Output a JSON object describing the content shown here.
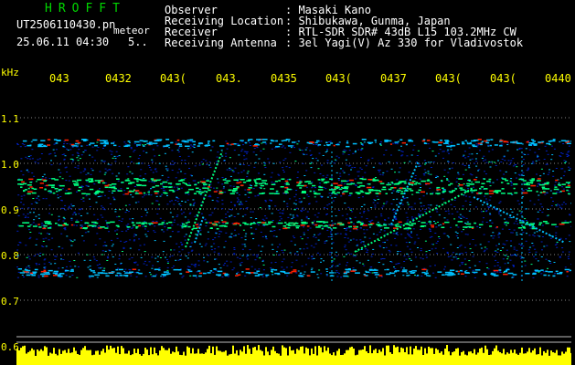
{
  "header": {
    "app_title": "HROFFT",
    "filename": "UT2506110430.pn",
    "mode": "meteor",
    "datetime": "25.06.11 04:30",
    "extra": "5..",
    "fields": [
      {
        "label": "Observer",
        "value": ": Masaki Kano"
      },
      {
        "label": "Receiving Location",
        "value": ": Shibukawa, Gunma, Japan"
      },
      {
        "label": "Receiver",
        "value": ": RTL-SDR SDR# 43dB L15 103.2MHz CW"
      },
      {
        "label": "Receiving Antenna",
        "value": ": 3el Yagi(V) Az 330 for Vladivostok"
      }
    ]
  },
  "x_axis": {
    "ticks": [
      "043",
      "0432",
      "043(",
      "043.",
      "0435",
      "043(",
      "0437",
      "043(",
      "043(",
      "0440"
    ]
  },
  "y_axis": {
    "unit": "kHz",
    "ticks": [
      "1.1",
      "1.0",
      "0.9",
      "0.8",
      "0.7",
      "0.6"
    ]
  },
  "colors": {
    "background": "#000000",
    "label_yellow": "#ffff00",
    "title_green": "#00d800",
    "grid_white": "#ffffff",
    "noise_blue": "#0020c0",
    "noise_cyan": "#00c0ff",
    "signal_green": "#00ff80",
    "signal_red": "#ff2000",
    "level_bar_yellow": "#ffff00"
  }
}
